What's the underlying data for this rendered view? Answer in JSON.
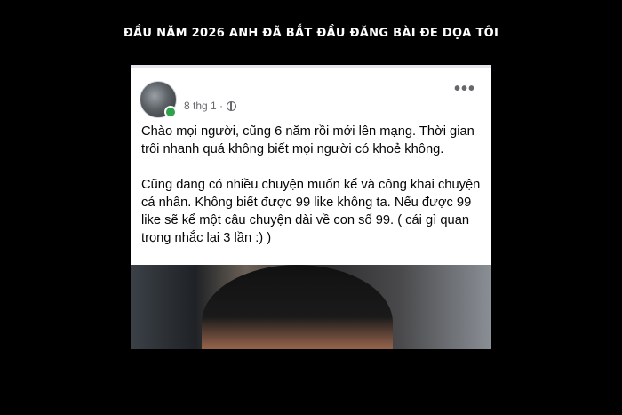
{
  "headline": "ĐẦU NĂM 2026 ANH ĐÃ BẮT ĐẦU ĐĂNG BÀI ĐE DỌA TÔI",
  "post": {
    "date": "8 thg 1 ·",
    "more_glyph": "•••",
    "paragraphs": [
      "Chào mọi người, cũng 6 năm rồi mới lên mạng. Thời gian trôi nhanh quá không biết mọi người có khoẻ không.",
      "Cũng đang có nhiều chuyện muốn kể và công khai chuyện cá nhân. Không biết được 99 like không ta. Nếu được 99 like sẽ kể một câu chuyện dài về con số 99. ( cái gì quan trọng nhắc lại 3 lần :) )"
    ]
  },
  "icons": {
    "privacy": "globe-icon",
    "menu": "more-options-icon"
  },
  "colors": {
    "background": "#000000",
    "card": "#ffffff",
    "meta_text": "#65676b",
    "online": "#31a24c"
  }
}
